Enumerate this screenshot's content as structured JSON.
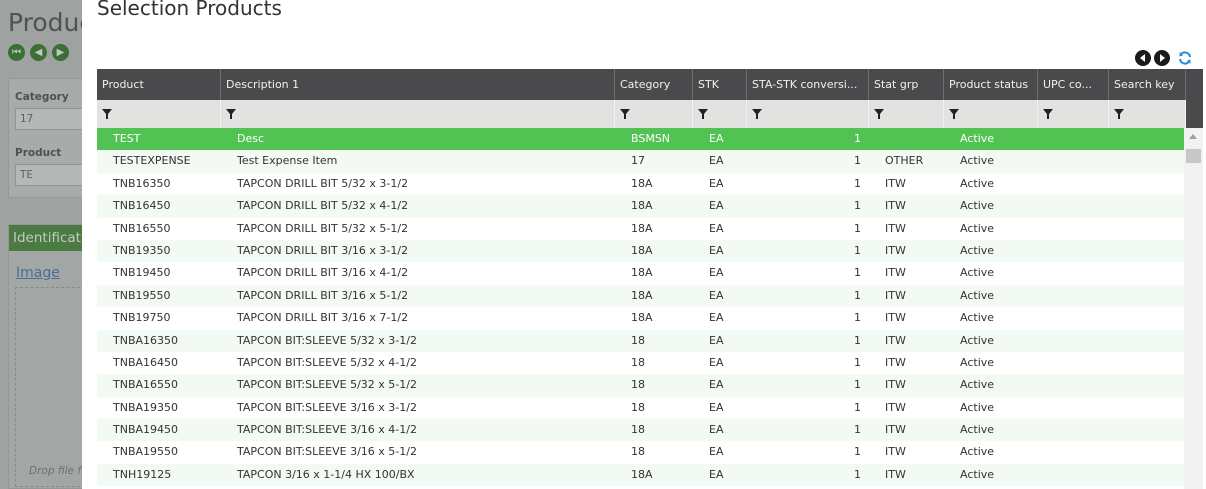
{
  "background": {
    "title": "Produc",
    "nav_icons": [
      "first-icon",
      "previous-icon",
      "next-icon"
    ],
    "category_label": "Category",
    "category_value": "17",
    "product_label": "Product",
    "product_value": "TE",
    "section_title": "Identificat",
    "image_link": "Image",
    "drop_text": "Drop file fi"
  },
  "modal": {
    "title": "Selection Products",
    "toolbar": {
      "prev_icon": "chevron-left-icon",
      "next_icon": "chevron-right-icon",
      "refresh_icon": "refresh-icon"
    }
  },
  "grid": {
    "columns": [
      "Product",
      "Description 1",
      "Category",
      "STK",
      "STA-STK conversi...",
      "Stat grp",
      "Product status",
      "UPC co...",
      "Search key"
    ],
    "rows": [
      {
        "product": "TEST",
        "desc": "Desc",
        "cat": "BSMSN",
        "stk": "EA",
        "conv": "1",
        "stat": "",
        "status": "Active",
        "upc": "",
        "search": ""
      },
      {
        "product": "TESTEXPENSE",
        "desc": "Test Expense Item",
        "cat": "17",
        "stk": "EA",
        "conv": "1",
        "stat": "OTHER",
        "status": "Active",
        "upc": "",
        "search": ""
      },
      {
        "product": "TNB16350",
        "desc": "TAPCON DRILL BIT 5/32 x 3-1/2",
        "cat": "18A",
        "stk": "EA",
        "conv": "1",
        "stat": "ITW",
        "status": "Active",
        "upc": "",
        "search": ""
      },
      {
        "product": "TNB16450",
        "desc": "TAPCON DRILL BIT 5/32 x 4-1/2",
        "cat": "18A",
        "stk": "EA",
        "conv": "1",
        "stat": "ITW",
        "status": "Active",
        "upc": "",
        "search": ""
      },
      {
        "product": "TNB16550",
        "desc": "TAPCON DRILL BIT 5/32 x 5-1/2",
        "cat": "18A",
        "stk": "EA",
        "conv": "1",
        "stat": "ITW",
        "status": "Active",
        "upc": "",
        "search": ""
      },
      {
        "product": "TNB19350",
        "desc": "TAPCON DRILL BIT 3/16 x 3-1/2",
        "cat": "18A",
        "stk": "EA",
        "conv": "1",
        "stat": "ITW",
        "status": "Active",
        "upc": "",
        "search": ""
      },
      {
        "product": "TNB19450",
        "desc": "TAPCON DRILL BIT 3/16 x 4-1/2",
        "cat": "18A",
        "stk": "EA",
        "conv": "1",
        "stat": "ITW",
        "status": "Active",
        "upc": "",
        "search": ""
      },
      {
        "product": "TNB19550",
        "desc": "TAPCON DRILL BIT 3/16 x 5-1/2",
        "cat": "18A",
        "stk": "EA",
        "conv": "1",
        "stat": "ITW",
        "status": "Active",
        "upc": "",
        "search": ""
      },
      {
        "product": "TNB19750",
        "desc": "TAPCON DRILL BIT 3/16 x 7-1/2",
        "cat": "18A",
        "stk": "EA",
        "conv": "1",
        "stat": "ITW",
        "status": "Active",
        "upc": "",
        "search": ""
      },
      {
        "product": "TNBA16350",
        "desc": "TAPCON BIT:SLEEVE 5/32 x 3-1/2",
        "cat": "18",
        "stk": "EA",
        "conv": "1",
        "stat": "ITW",
        "status": "Active",
        "upc": "",
        "search": ""
      },
      {
        "product": "TNBA16450",
        "desc": "TAPCON BIT:SLEEVE 5/32 x 4-1/2",
        "cat": "18",
        "stk": "EA",
        "conv": "1",
        "stat": "ITW",
        "status": "Active",
        "upc": "",
        "search": ""
      },
      {
        "product": "TNBA16550",
        "desc": "TAPCON BIT:SLEEVE 5/32 x 5-1/2",
        "cat": "18",
        "stk": "EA",
        "conv": "1",
        "stat": "ITW",
        "status": "Active",
        "upc": "",
        "search": ""
      },
      {
        "product": "TNBA19350",
        "desc": "TAPCON BIT:SLEEVE 3/16 x 3-1/2",
        "cat": "18",
        "stk": "EA",
        "conv": "1",
        "stat": "ITW",
        "status": "Active",
        "upc": "",
        "search": ""
      },
      {
        "product": "TNBA19450",
        "desc": "TAPCON BIT:SLEEVE 3/16 x 4-1/2",
        "cat": "18",
        "stk": "EA",
        "conv": "1",
        "stat": "ITW",
        "status": "Active",
        "upc": "",
        "search": ""
      },
      {
        "product": "TNBA19550",
        "desc": "TAPCON BIT:SLEEVE 3/16 x 5-1/2",
        "cat": "18",
        "stk": "EA",
        "conv": "1",
        "stat": "ITW",
        "status": "Active",
        "upc": "",
        "search": ""
      },
      {
        "product": "TNH19125",
        "desc": "TAPCON 3/16 x 1-1/4 HX 100/BX",
        "cat": "18A",
        "stk": "EA",
        "conv": "1",
        "stat": "ITW",
        "status": "Active",
        "upc": "",
        "search": ""
      }
    ],
    "selected_row": 0,
    "selected_color": "#52c352",
    "header_color": "#4a4a4d"
  }
}
